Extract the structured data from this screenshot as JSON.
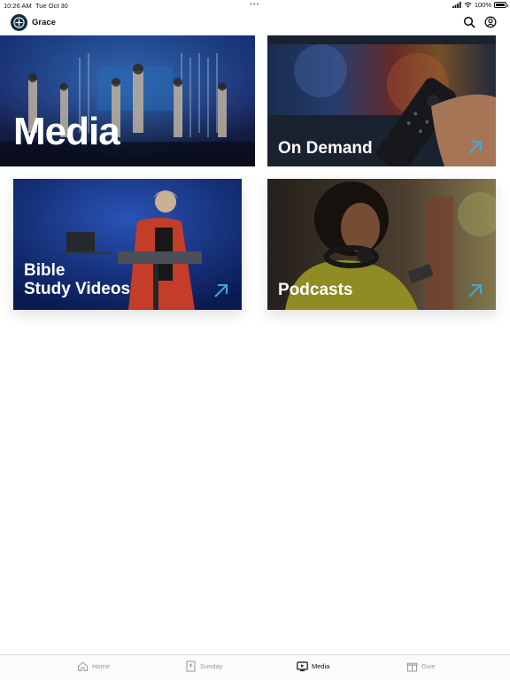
{
  "status_bar": {
    "time": "10:26 AM",
    "date": "Tue Oct 30",
    "more_dots": "•••",
    "battery": "100%"
  },
  "header": {
    "app_name": "Grace",
    "icons": [
      "search-icon",
      "account-icon"
    ]
  },
  "tiles": [
    {
      "label": "Media"
    },
    {
      "label": "On Demand"
    },
    {
      "label_line1": "Bible",
      "label_line2": "Study Videos"
    },
    {
      "label": "Podcasts"
    }
  ],
  "colors": {
    "accent_arrow": "#3fa9d6",
    "logo_bg": "#0f2a3f"
  },
  "tab_bar": {
    "items": [
      {
        "label": "Home",
        "icon": "home-icon",
        "active": false
      },
      {
        "label": "Sunday",
        "icon": "bible-icon",
        "active": false
      },
      {
        "label": "Media",
        "icon": "tv-icon",
        "active": true
      },
      {
        "label": "Give",
        "icon": "gift-icon",
        "active": false
      }
    ]
  }
}
